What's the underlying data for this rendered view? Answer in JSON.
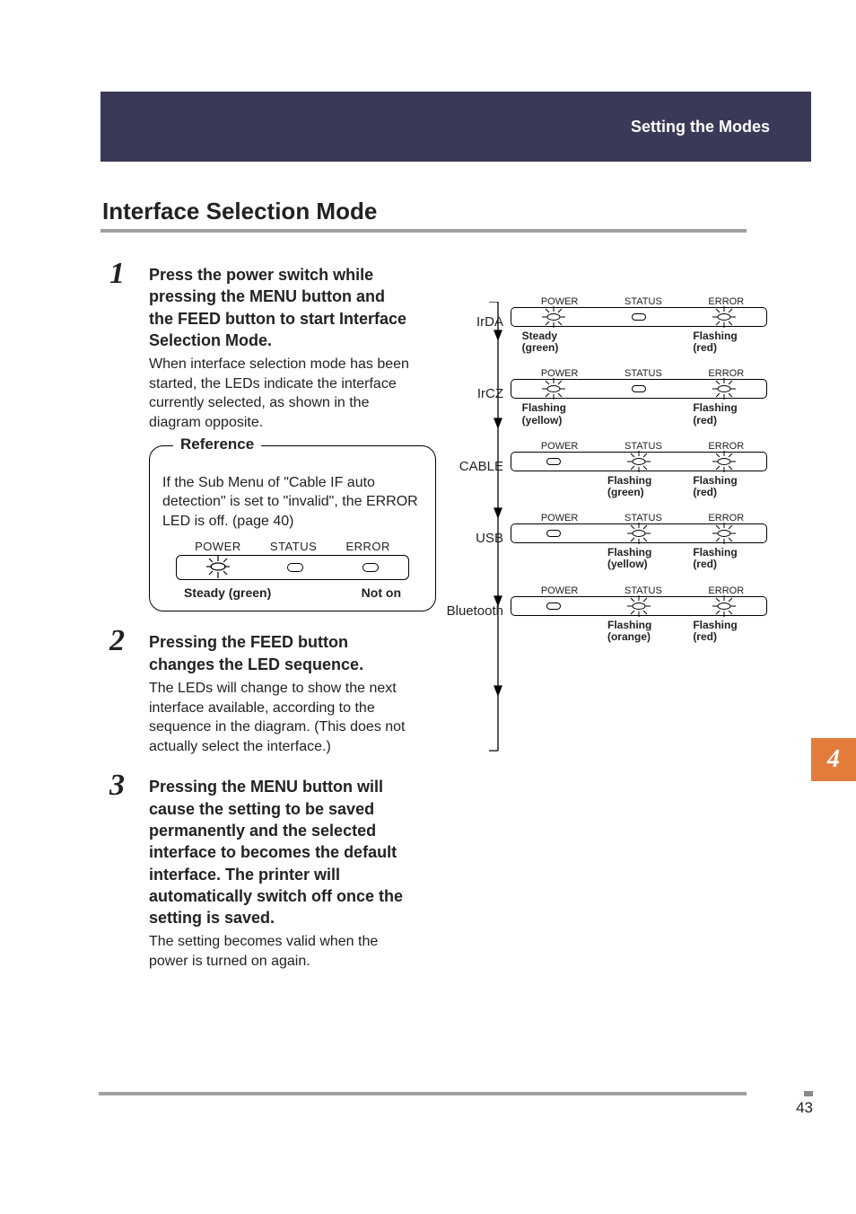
{
  "header": {
    "section": "Setting the Modes"
  },
  "title": "Interface Selection Mode",
  "steps": [
    {
      "num": "1",
      "head": "Press the power switch while pressing the MENU button and the FEED button to start Interface Selection Mode.",
      "body": "When interface selection mode has been started, the LEDs indicate the interface currently selected, as shown in the diagram opposite."
    },
    {
      "num": "2",
      "head": "Pressing the FEED button changes the LED sequence.",
      "body": "The LEDs will change to show the next interface available, according to the sequence in the diagram. (This does not actually select the interface.)"
    },
    {
      "num": "3",
      "head": "Pressing the MENU button will cause the setting to be saved permanently and the selected interface to becomes the default interface. The printer will automatically switch off once the setting is saved.",
      "body": "The setting becomes valid when the power is turned on again."
    }
  ],
  "reference": {
    "label": "Reference",
    "text": "If the Sub Menu of \"Cable IF auto detection\" is set to \"invalid\", the ERROR LED is off. (page 40)",
    "led_headers": {
      "power": "POWER",
      "status": "STATUS",
      "error": "ERROR"
    },
    "led_states": {
      "left": "Steady (green)",
      "right": "Not on"
    }
  },
  "diagram": {
    "led_headers": {
      "power": "POWER",
      "status": "STATUS",
      "error": "ERROR"
    },
    "rows": [
      {
        "name": "IrDA",
        "power": "Steady (green)",
        "status": "",
        "error": "Flashing (red)"
      },
      {
        "name": "IrCZ",
        "power": "Flashing (yellow)",
        "status": "",
        "error": "Flashing (red)"
      },
      {
        "name": "CABLE",
        "power": "",
        "status": "Flashing (green)",
        "error": "Flashing (red)"
      },
      {
        "name": "USB",
        "power": "",
        "status": "Flashing (yellow)",
        "error": "Flashing (red)"
      },
      {
        "name": "Bluetooth",
        "power": "",
        "status": "Flashing (orange)",
        "error": "Flashing (red)"
      }
    ]
  },
  "chapter_tab": "4",
  "page_number": "43"
}
